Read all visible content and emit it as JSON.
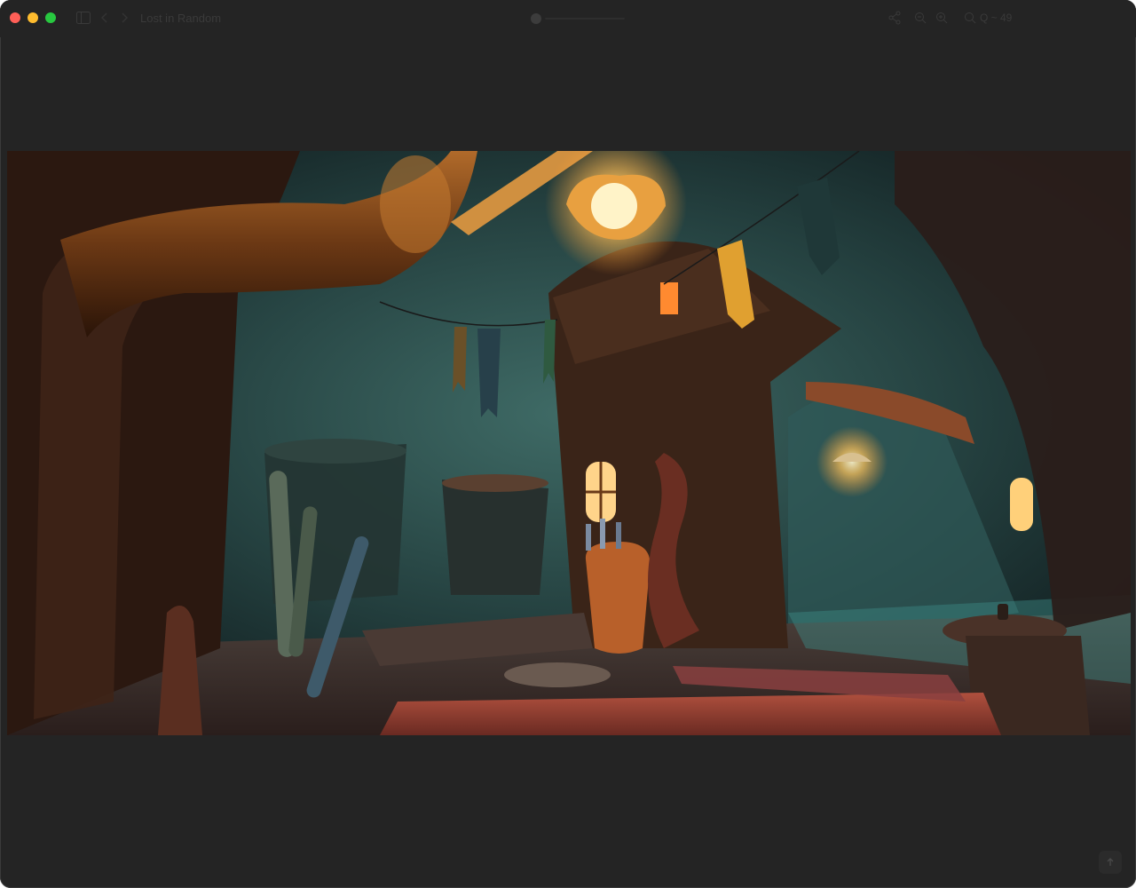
{
  "window": {
    "title": "Lost in Random",
    "search_label": "Q ~ 49"
  },
  "toolbar": {
    "icons": [
      "sidebar-icon",
      "chevron-left-icon",
      "chevron-right-icon",
      "share-icon",
      "zoom-out-icon",
      "zoom-in-icon",
      "search-icon"
    ]
  },
  "image": {
    "description_icon": "game-screenshot"
  },
  "colors": {
    "window_bg": "#242424",
    "close": "#ff5f57",
    "minimize": "#febc2e",
    "maximize": "#28c840"
  }
}
